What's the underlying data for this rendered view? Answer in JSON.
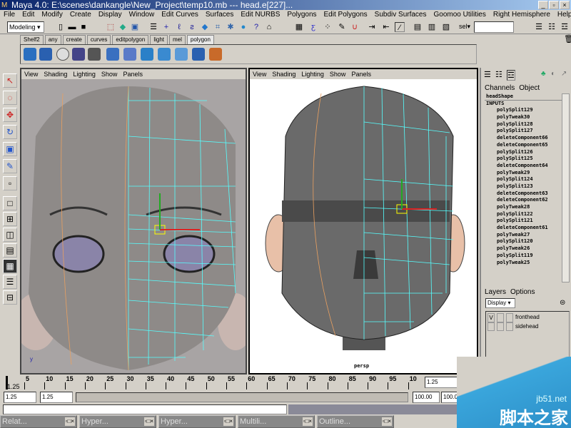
{
  "window": {
    "title": "Maya 4.0: E:\\scenes\\dankangle\\New_Project\\temp10.mb  ---  head.e[227]...",
    "buttons": [
      "_",
      "▫",
      "×"
    ]
  },
  "menu": [
    "File",
    "Edit",
    "Modify",
    "Create",
    "Display",
    "Window",
    "Edit Curves",
    "Surfaces",
    "Edit NURBS",
    "Polygons",
    "Edit Polygons",
    "Subdiv Surfaces",
    "Goomoo Utilities",
    "Right Hemisphere",
    "Help"
  ],
  "toolbar": {
    "mode": "Modeling",
    "sel_label": "sel▾",
    "sel_value": ""
  },
  "shelf": {
    "tabs": [
      "Shelf2",
      "any",
      "create",
      "curves",
      "editpolygon",
      "light",
      "mel",
      "polygon"
    ],
    "active": "polygon"
  },
  "viewports": [
    {
      "menu": [
        "View",
        "Shading",
        "Lighting",
        "Show",
        "Panels"
      ],
      "label": ""
    },
    {
      "menu": [
        "View",
        "Shading",
        "Lighting",
        "Show",
        "Panels"
      ],
      "label": "persp"
    }
  ],
  "channel_box": {
    "tabs": [
      "Channels",
      "Object"
    ],
    "node": "headShape",
    "section": "INPUTS",
    "items": [
      "polySplit129",
      "polyTweak30",
      "polySplit128",
      "polySplit127",
      "deleteComponent66",
      "deleteComponent65",
      "polySplit126",
      "polySplit125",
      "deleteComponent64",
      "polyTweak29",
      "polySplit124",
      "polySplit123",
      "deleteComponent63",
      "deleteComponent62",
      "polyTweak28",
      "polySplit122",
      "polySplit121",
      "deleteComponent61",
      "polyTweak27",
      "polySplit120",
      "polyTweak26",
      "polySplit119",
      "polyTweak25"
    ]
  },
  "layers": {
    "menu": [
      "Layers",
      "Options"
    ],
    "display": "Display",
    "items": [
      {
        "v": "V",
        "name": "fronthead"
      },
      {
        "v": "",
        "name": "sidehead"
      }
    ]
  },
  "timeline": {
    "ticks": [
      "5",
      "10",
      "15",
      "20",
      "25",
      "30",
      "35",
      "40",
      "45",
      "50",
      "55",
      "60",
      "65",
      "70",
      "75",
      "80",
      "85",
      "90",
      "95",
      "10"
    ],
    "current": "1.25",
    "current_field": "1.25"
  },
  "range": {
    "start": "1.25",
    "start2": "1.25",
    "end": "100.00",
    "end2": "100.0"
  },
  "taskbar": [
    "Relat...",
    "Hyper...",
    "Hyper...",
    "Multili...",
    "Outline..."
  ],
  "watermark": {
    "site": "jb51.net",
    "name": "脚本之家"
  }
}
